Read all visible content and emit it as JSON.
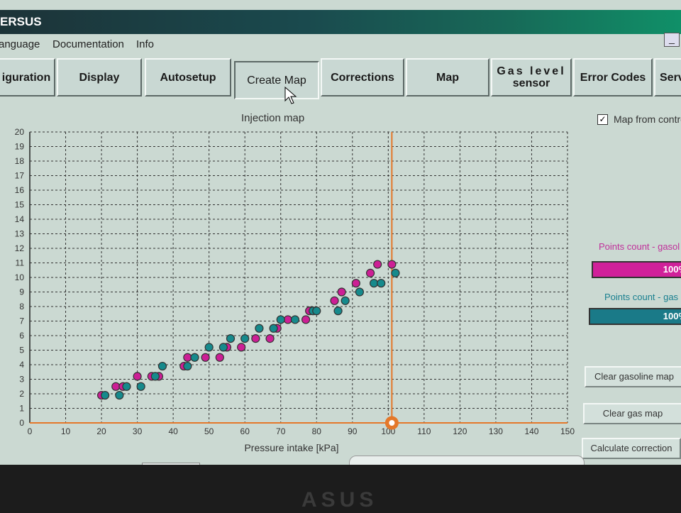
{
  "window": {
    "title": "ERSUS"
  },
  "menu": {
    "language": "anguage",
    "documentation": "Documentation",
    "info": "Info"
  },
  "minimize_glyph": "_",
  "tabs": [
    {
      "id": "configuration",
      "label": "iguration"
    },
    {
      "id": "display",
      "label": "Display"
    },
    {
      "id": "autosetup",
      "label": "Autosetup"
    },
    {
      "id": "create-map",
      "label": "Create Map",
      "active": true
    },
    {
      "id": "corrections",
      "label": "Corrections"
    },
    {
      "id": "map",
      "label": "Map"
    },
    {
      "id": "gas-level-sensor",
      "line1": "Gas level",
      "line2": "sensor"
    },
    {
      "id": "error-codes",
      "label": "Error Codes"
    },
    {
      "id": "service",
      "label": "Serv"
    }
  ],
  "right_panel": {
    "map_from_controller": {
      "label": "Map from contro",
      "checked": true,
      "mark": "✓"
    },
    "gasoline_points": {
      "label": "Points count - gasol",
      "value": "100%",
      "fraction": 1.0,
      "color": "#d0209a"
    },
    "gas_points": {
      "label": "Points count - gas",
      "value": "100%",
      "fraction": 1.0,
      "color": "#1a7a88"
    },
    "buttons": {
      "clear_gasoline": "Clear gasoline map",
      "clear_gas": "Clear gas map",
      "calculate": "Calculate correction"
    }
  },
  "colors": {
    "gasoline": "#cc1f95",
    "gas": "#168a8c",
    "cursor": "#e4782a",
    "grid": "#333333"
  },
  "chart_data": {
    "type": "scatter",
    "title": "Injection map",
    "xlabel": "Pressure intake [kPa]",
    "ylabel": "",
    "xlim": [
      0,
      150
    ],
    "ylim": [
      0,
      20
    ],
    "xticks": [
      0,
      10,
      20,
      30,
      40,
      50,
      60,
      70,
      80,
      90,
      100,
      110,
      120,
      130,
      140,
      150
    ],
    "yticks": [
      0,
      1,
      2,
      3,
      4,
      5,
      6,
      7,
      8,
      9,
      10,
      11,
      12,
      13,
      14,
      15,
      16,
      17,
      18,
      19,
      20
    ],
    "grid": true,
    "cursor_x": 101,
    "series": [
      {
        "key": "gasoline",
        "points": [
          [
            20,
            1.9
          ],
          [
            24,
            2.5
          ],
          [
            26,
            2.5
          ],
          [
            30,
            3.2
          ],
          [
            34,
            3.2
          ],
          [
            36,
            3.2
          ],
          [
            43,
            3.9
          ],
          [
            44,
            4.5
          ],
          [
            49,
            4.5
          ],
          [
            53,
            4.5
          ],
          [
            55,
            5.2
          ],
          [
            59,
            5.2
          ],
          [
            63,
            5.8
          ],
          [
            67,
            5.8
          ],
          [
            69,
            6.5
          ],
          [
            72,
            7.1
          ],
          [
            77,
            7.1
          ],
          [
            78,
            7.7
          ],
          [
            85,
            8.4
          ],
          [
            87,
            9.0
          ],
          [
            91,
            9.6
          ],
          [
            95,
            10.3
          ],
          [
            97,
            10.9
          ],
          [
            101,
            10.9
          ]
        ]
      },
      {
        "key": "gas",
        "points": [
          [
            21,
            1.9
          ],
          [
            25,
            1.9
          ],
          [
            27,
            2.5
          ],
          [
            31,
            2.5
          ],
          [
            35,
            3.2
          ],
          [
            37,
            3.9
          ],
          [
            44,
            3.9
          ],
          [
            46,
            4.5
          ],
          [
            50,
            5.2
          ],
          [
            54,
            5.2
          ],
          [
            56,
            5.8
          ],
          [
            60,
            5.8
          ],
          [
            64,
            6.5
          ],
          [
            68,
            6.5
          ],
          [
            70,
            7.1
          ],
          [
            74,
            7.1
          ],
          [
            79,
            7.7
          ],
          [
            80,
            7.7
          ],
          [
            86,
            7.7
          ],
          [
            88,
            8.4
          ],
          [
            92,
            9.0
          ],
          [
            96,
            9.6
          ],
          [
            98,
            9.6
          ],
          [
            102,
            10.3
          ]
        ]
      }
    ]
  },
  "bezel": {
    "brand": "ASUS"
  }
}
